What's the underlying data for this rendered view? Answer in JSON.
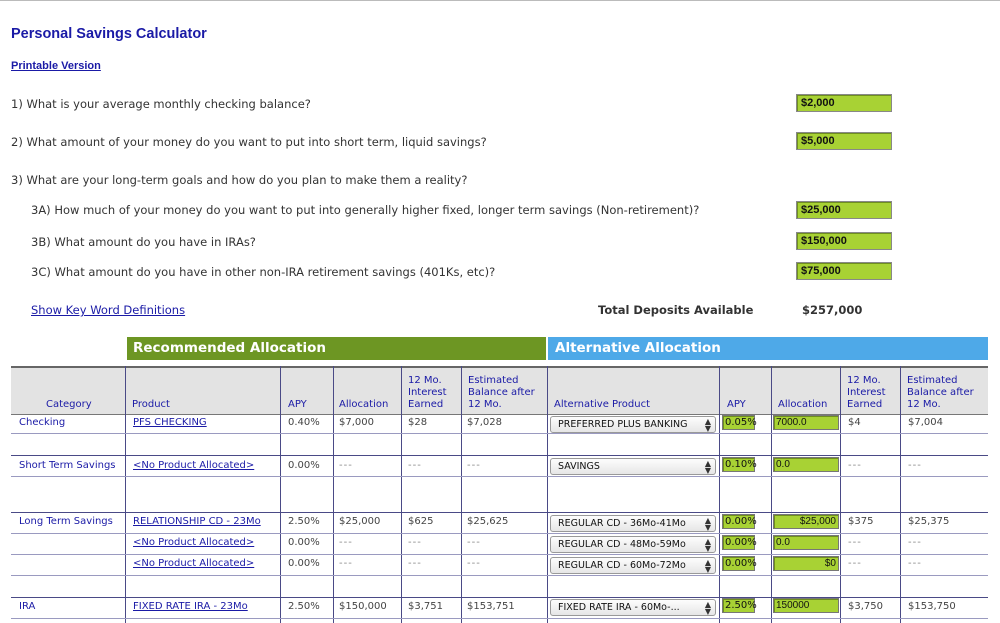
{
  "page": {
    "title": "Personal Savings Calculator",
    "printable_link": "Printable Version"
  },
  "questions": {
    "q1": "1) What is your average monthly checking balance?",
    "q2": "2) What amount of your money do you want to put into short term, liquid savings?",
    "q3": "3) What are your long-term goals and how do you plan to make them a reality?",
    "q3a": "3A) How much of your money do you want to put into generally higher fixed, longer term savings (Non-retirement)?",
    "q3b": "3B) What amount do you have in IRAs?",
    "q3c": "3C) What amount do you have in other non-IRA retirement savings (401Ks, etc)?"
  },
  "answers": {
    "q1": "$2,000",
    "q2": "$5,000",
    "q3a": "$25,000",
    "q3b": "$150,000",
    "q3c": "$75,000"
  },
  "keyword_link": "Show Key Word Definitions",
  "total": {
    "label": "Total Deposits Available",
    "value": "$257,000"
  },
  "sections": {
    "recommended": "Recommended Allocation",
    "alternative": "Alternative Allocation"
  },
  "columns": {
    "category": "Category",
    "product": "Product",
    "apy": "APY",
    "allocation": "Allocation",
    "interest": "12 Mo. Interest Earned",
    "balance": "Estimated Balance after 12 Mo.",
    "alt_product": "Alternative Product",
    "alt_apy": "APY",
    "alt_allocation": "Allocation",
    "alt_interest": "12 Mo. Interest Earned",
    "alt_balance": "Estimated Balance after 12 Mo."
  },
  "rows": [
    {
      "category": "Checking",
      "product": "PFS CHECKING",
      "apy": "0.40%",
      "allocation": "$7,000",
      "interest": "$28",
      "balance": "$7,028",
      "alt_product": "PREFERRED PLUS BANKING",
      "alt_apy": "0.05%",
      "alt_allocation": "7000.0",
      "alt_interest": "$4",
      "alt_balance": "$7,004"
    },
    {
      "category": "Short Term Savings",
      "product": "<No Product Allocated>",
      "apy": "0.00%",
      "allocation": "---",
      "interest": "---",
      "balance": "---",
      "alt_product": "SAVINGS",
      "alt_apy": "0.10%",
      "alt_allocation": "0.0",
      "alt_interest": "---",
      "alt_balance": "---"
    },
    {
      "category": "Long Term Savings",
      "product": "RELATIONSHIP CD - 23Mo",
      "apy": "2.50%",
      "allocation": "$25,000",
      "interest": "$625",
      "balance": "$25,625",
      "alt_product": "REGULAR CD - 36Mo-41Mo",
      "alt_apy": "0.00%",
      "alt_allocation": "$25,000",
      "alt_interest": "$375",
      "alt_balance": "$25,375"
    },
    {
      "category": "",
      "product": "<No Product Allocated>",
      "apy": "0.00%",
      "allocation": "---",
      "interest": "---",
      "balance": "---",
      "alt_product": "REGULAR CD - 48Mo-59Mo",
      "alt_apy": "0.00%",
      "alt_allocation": "0.0",
      "alt_interest": "---",
      "alt_balance": "---"
    },
    {
      "category": "",
      "product": "<No Product Allocated>",
      "apy": "0.00%",
      "allocation": "---",
      "interest": "---",
      "balance": "---",
      "alt_product": "REGULAR CD - 60Mo-72Mo",
      "alt_apy": "0.00%",
      "alt_allocation": "$0",
      "alt_interest": "---",
      "alt_balance": "---"
    },
    {
      "category": "IRA",
      "product": "FIXED RATE IRA - 23Mo",
      "apy": "2.50%",
      "allocation": "$150,000",
      "interest": "$3,751",
      "balance": "$153,751",
      "alt_product": "FIXED RATE IRA - 60Mo-...",
      "alt_apy": "2.50%",
      "alt_allocation": "150000",
      "alt_interest": "$3,750",
      "alt_balance": "$153,750"
    }
  ],
  "colors": {
    "recommended_header": "#6d9623",
    "alternative_header": "#4ea9e8",
    "input_green": "#a8d234",
    "title_blue": "#1a1aa6"
  },
  "icons": {
    "select_arrow": "up-down-chevron-icon"
  }
}
